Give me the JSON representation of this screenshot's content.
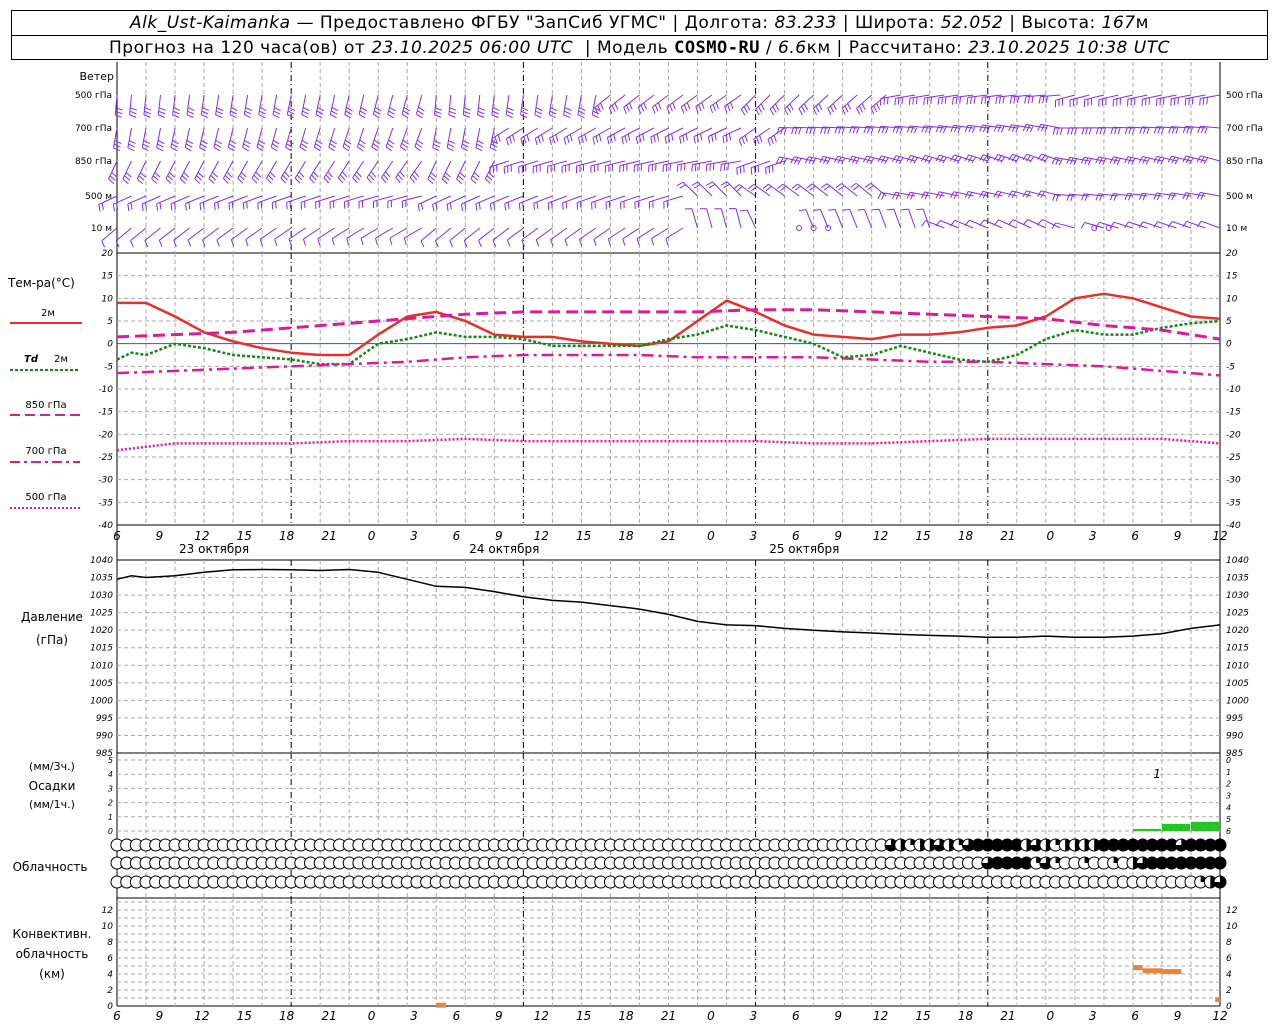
{
  "header": {
    "station": "Alk_Ust-Kaimanka",
    "provider": "— Предоставлено ФГБУ \"ЗапСиб УГМС\"",
    "lon_label": "Долгота:",
    "lon_value": "83.233",
    "lat_label": "Широта:",
    "lat_value": "52.052",
    "alt_label": "Высота:",
    "alt_value": "167",
    "alt_unit": "м",
    "forecast_label": "Прогноз на 120 часа(ов) от",
    "forecast_time": "23.10.2025 06:00 UTC",
    "model_label": "Модель",
    "model_name": "COSMO-RU",
    "model_res": "6.6",
    "model_unit": "км",
    "calc_label": "Рассчитано:",
    "calc_time": "23.10.2025 10:38 UTC"
  },
  "colors": {
    "wind": "#8a2be2",
    "t2m": "#e8302a",
    "td2m": "#138a13",
    "t850": "#dd1a9a",
    "t700": "#dd1a9a",
    "t500": "#dd1a9a",
    "pressure": "#000000",
    "precip": "#22c522",
    "convective": "#e8853a",
    "grid": "#aaaaaa"
  },
  "chart_data": [
    {
      "type": "wind_barbs",
      "title": "Ветер",
      "levels": [
        "500 гПа",
        "700 гПа",
        "850 гПа",
        "500 м",
        "10 м"
      ]
    },
    {
      "type": "line",
      "title": "Тем-ра(°C)",
      "ylim": [
        -40,
        20
      ],
      "yticks": [
        20,
        15,
        10,
        5,
        0,
        -5,
        -10,
        -15,
        -20,
        -25,
        -30,
        -35,
        -40
      ],
      "series": [
        {
          "name": "2м",
          "style": "solid",
          "x": [
            0,
            3,
            6,
            9,
            12,
            15,
            18,
            21,
            24,
            27,
            30,
            33,
            36,
            39,
            42,
            45,
            48,
            51,
            54,
            57,
            60,
            63,
            66,
            69,
            72,
            75,
            78,
            81,
            84,
            87,
            90,
            93,
            96,
            99,
            102,
            105,
            108,
            111,
            114
          ],
          "y": [
            9,
            9,
            6,
            2.5,
            0.5,
            -1,
            -2,
            -2.5,
            -2.5,
            2,
            6,
            7,
            5,
            2,
            1.5,
            1.5,
            0.5,
            0,
            -0.5,
            0.5,
            5,
            9.5,
            7,
            4,
            2,
            1.5,
            1,
            2,
            2,
            2.5,
            3.5,
            4,
            6,
            10,
            11,
            10,
            8,
            6,
            5.5
          ]
        },
        {
          "name": "Td 2м",
          "style": "dotted",
          "x": [
            0,
            1.5,
            3,
            6,
            9,
            12,
            15,
            18,
            21,
            24,
            27,
            30,
            33,
            36,
            39,
            42,
            45,
            48,
            51,
            54,
            57,
            60,
            63,
            66,
            69,
            72,
            75,
            78,
            81,
            84,
            87,
            90,
            93,
            96,
            99,
            102,
            105,
            108,
            111,
            114
          ],
          "y": [
            -3.5,
            -2,
            -2.5,
            0,
            -1,
            -2.5,
            -3,
            -3.5,
            -4.5,
            -4.5,
            0,
            1,
            2.5,
            1.5,
            1.5,
            1,
            -0.5,
            -0.5,
            -0.5,
            -0.5,
            1,
            2,
            4,
            3,
            1.5,
            0,
            -3,
            -2.5,
            -0.5,
            -2,
            -3.5,
            -4,
            -2.5,
            1,
            3,
            2,
            2,
            3.5,
            4.5,
            5
          ]
        },
        {
          "name": "850 гПа",
          "style": "dashed",
          "x": [
            0,
            6,
            12,
            18,
            24,
            30,
            36,
            42,
            48,
            54,
            60,
            66,
            72,
            78,
            84,
            90,
            96,
            102,
            108,
            114
          ],
          "y": [
            1.5,
            2,
            2.5,
            3.5,
            4.5,
            5.5,
            6.5,
            7,
            7,
            7,
            7,
            7.5,
            7.5,
            7,
            6.5,
            6,
            5.5,
            4,
            3,
            1
          ]
        },
        {
          "name": "700 гПа",
          "style": "dashdot",
          "x": [
            0,
            6,
            12,
            18,
            24,
            30,
            36,
            42,
            48,
            54,
            60,
            66,
            72,
            78,
            84,
            90,
            96,
            102,
            108,
            114
          ],
          "y": [
            -6.5,
            -6,
            -5.5,
            -5,
            -4.5,
            -4,
            -3,
            -2.5,
            -2.5,
            -2.5,
            -3,
            -3,
            -3,
            -3.5,
            -4,
            -4,
            -4.5,
            -5,
            -6,
            -7
          ]
        },
        {
          "name": "500 гПа",
          "style": "dotted-fine",
          "x": [
            0,
            6,
            12,
            18,
            24,
            30,
            36,
            42,
            48,
            54,
            60,
            66,
            72,
            78,
            84,
            90,
            96,
            102,
            108,
            114
          ],
          "y": [
            -23.5,
            -22,
            -22,
            -22,
            -21.5,
            -21.5,
            -21,
            -21.5,
            -21.5,
            -21.5,
            -21.5,
            -21.5,
            -22,
            -22,
            -21.5,
            -21,
            -21,
            -21,
            -21,
            -22
          ]
        }
      ],
      "x_ticks": [
        "6",
        "9",
        "12",
        "15",
        "18",
        "21",
        "0",
        "3",
        "6",
        "9",
        "12",
        "15",
        "18",
        "21",
        "0",
        "3",
        "6",
        "9",
        "12",
        "15",
        "18",
        "21",
        "0",
        "3",
        "6",
        "9",
        "12"
      ],
      "days": [
        "23 октября",
        "24 октября",
        "25 октября"
      ]
    },
    {
      "type": "line",
      "title": "Давление",
      "ylabel": "(гПа)",
      "ylim": [
        985,
        1040
      ],
      "yticks": [
        1040,
        1035,
        1030,
        1025,
        1020,
        1015,
        1010,
        1005,
        1000,
        995,
        990,
        985
      ],
      "series": [
        {
          "x": [
            0,
            1.5,
            3,
            6,
            9,
            12,
            15,
            18,
            21,
            24,
            27,
            30,
            33,
            36,
            39,
            42,
            45,
            48,
            51,
            54,
            57,
            60,
            63,
            66,
            69,
            72,
            75,
            78,
            81,
            84,
            87,
            90,
            93,
            96,
            99,
            102,
            105,
            108,
            111,
            114
          ],
          "y": [
            1034.5,
            1035.5,
            1035,
            1035.5,
            1036.5,
            1037.2,
            1037.3,
            1037.2,
            1037.0,
            1037.3,
            1036.5,
            1034.5,
            1032.5,
            1032.2,
            1031.0,
            1029.5,
            1028.5,
            1028.0,
            1027.0,
            1026.0,
            1024.5,
            1022.5,
            1021.5,
            1021.3,
            1020.5,
            1020.0,
            1019.5,
            1019.2,
            1018.8,
            1018.5,
            1018.3,
            1018.0,
            1018.0,
            1018.3,
            1018.0,
            1018.0,
            1018.3,
            1019.0,
            1020.5,
            1021.5
          ]
        }
      ]
    },
    {
      "type": "bar",
      "title": "Осадки",
      "ylabel_left_top": "(мм/3ч.)",
      "ylabel_left_bottom": "(мм/1ч.)",
      "ylim": [
        0,
        5
      ],
      "yticks_left": [
        5,
        4,
        3,
        2,
        1,
        0
      ],
      "yticks_right": [
        6,
        5,
        4,
        3,
        2,
        1,
        0
      ],
      "annotation": "1",
      "x": [
        105,
        108,
        111
      ],
      "values": [
        0.15,
        0.5,
        0.65
      ]
    },
    {
      "type": "cloud_cover",
      "title": "Облачность",
      "rows": [
        {
          "level": "upper",
          "values": [
            0,
            0,
            0,
            0,
            0,
            0,
            0,
            0,
            0,
            0,
            0,
            0,
            0,
            0,
            0,
            0,
            0,
            0,
            0,
            0,
            0,
            0,
            0,
            0,
            0,
            0,
            0,
            0,
            0,
            0,
            0,
            0,
            0,
            0,
            0,
            0,
            0,
            0,
            0,
            0,
            0,
            0,
            0,
            0,
            0,
            0,
            0,
            0,
            0,
            0,
            0,
            0,
            0,
            0,
            0,
            0,
            0,
            0,
            0,
            0,
            0,
            0,
            0,
            0,
            0,
            0,
            0,
            0,
            0,
            0,
            0,
            0,
            0,
            0,
            0,
            0,
            0,
            0,
            0,
            0,
            0.75,
            0.5,
            0.25,
            0.5,
            0.5,
            0.75,
            0.5,
            0.25,
            0.75,
            1,
            1,
            1,
            1,
            1,
            0.5,
            0.75,
            0.5,
            0.25,
            0.5,
            0.5,
            0.5,
            0.5,
            1,
            1,
            1,
            1,
            1,
            1,
            1,
            1,
            0.75,
            1,
            1,
            1,
            1
          ]
        },
        {
          "level": "middle",
          "values": [
            0,
            0,
            0,
            0,
            0,
            0,
            0,
            0,
            0,
            0,
            0,
            0,
            0,
            0,
            0,
            0,
            0,
            0,
            0,
            0,
            0,
            0,
            0,
            0,
            0,
            0,
            0,
            0,
            0,
            0,
            0,
            0,
            0,
            0,
            0,
            0,
            0,
            0,
            0,
            0,
            0,
            0,
            0,
            0,
            0,
            0,
            0,
            0,
            0,
            0,
            0,
            0,
            0,
            0,
            0,
            0,
            0,
            0,
            0,
            0,
            0,
            0,
            0,
            0,
            0,
            0,
            0,
            0,
            0,
            0,
            0,
            0,
            0,
            0,
            0,
            0,
            0,
            0,
            0,
            0,
            0,
            0,
            0,
            0,
            0,
            0,
            0,
            0,
            0,
            0,
            0.75,
            1,
            1,
            1,
            1,
            0.25,
            0.75,
            0.25,
            0,
            0,
            0.25,
            0,
            0,
            0.25,
            0,
            0.5,
            0.75,
            1,
            1,
            1,
            1,
            1,
            1,
            1,
            1
          ]
        },
        {
          "level": "lower",
          "values": [
            0,
            0,
            0,
            0,
            0,
            0,
            0,
            0,
            0,
            0,
            0,
            0,
            0,
            0,
            0,
            0,
            0,
            0,
            0,
            0,
            0,
            0,
            0,
            0,
            0,
            0,
            0,
            0,
            0,
            0,
            0,
            0,
            0,
            0,
            0,
            0,
            0,
            0,
            0,
            0,
            0,
            0,
            0,
            0,
            0,
            0,
            0,
            0,
            0,
            0,
            0,
            0,
            0,
            0,
            0,
            0,
            0,
            0,
            0,
            0,
            0,
            0,
            0,
            0,
            0,
            0,
            0,
            0,
            0,
            0,
            0,
            0,
            0,
            0,
            0,
            0,
            0,
            0,
            0,
            0,
            0,
            0,
            0,
            0,
            0,
            0,
            0,
            0,
            0,
            0,
            0,
            0,
            0,
            0,
            0,
            0,
            0,
            0,
            0,
            0,
            0,
            0,
            0,
            0,
            0,
            0,
            0,
            0,
            0,
            0,
            0,
            0,
            0.25,
            0.5,
            0.75
          ]
        }
      ]
    },
    {
      "type": "bar",
      "title": "Конвективн. облачность",
      "ylabel": "(км)",
      "ylim": [
        0,
        13
      ],
      "yticks": [
        12,
        10,
        8,
        6,
        4,
        2,
        0
      ],
      "segments": [
        {
          "x_start": 33,
          "x_end": 34,
          "value": 0.1
        },
        {
          "x_start": 105,
          "x_end": 106,
          "value": 4.8
        },
        {
          "x_start": 106,
          "x_end": 108,
          "value": 4.4
        },
        {
          "x_start": 108,
          "x_end": 110,
          "value": 4.3
        },
        {
          "x_start": 113.5,
          "x_end": 114,
          "value": 0.8
        }
      ]
    }
  ],
  "labels": {
    "wind": "Ветер",
    "temp_title": "Тем-ра(°C)",
    "legend_2m": "2м",
    "legend_td": "Td",
    "legend_td_suffix": "2м",
    "legend_850": "850 гПа",
    "legend_700": "700 гПа",
    "legend_500": "500 гПа",
    "pressure_title": "Давление",
    "pressure_unit": "(гПа)",
    "precip_unit_3h": "(мм/3ч.)",
    "precip_title": "Осадки",
    "precip_unit_1h": "(мм/1ч.)",
    "cloud_title": "Облачность",
    "conv_title_1": "Конвективн.",
    "conv_title_2": "облачность",
    "conv_unit": "(км)"
  }
}
